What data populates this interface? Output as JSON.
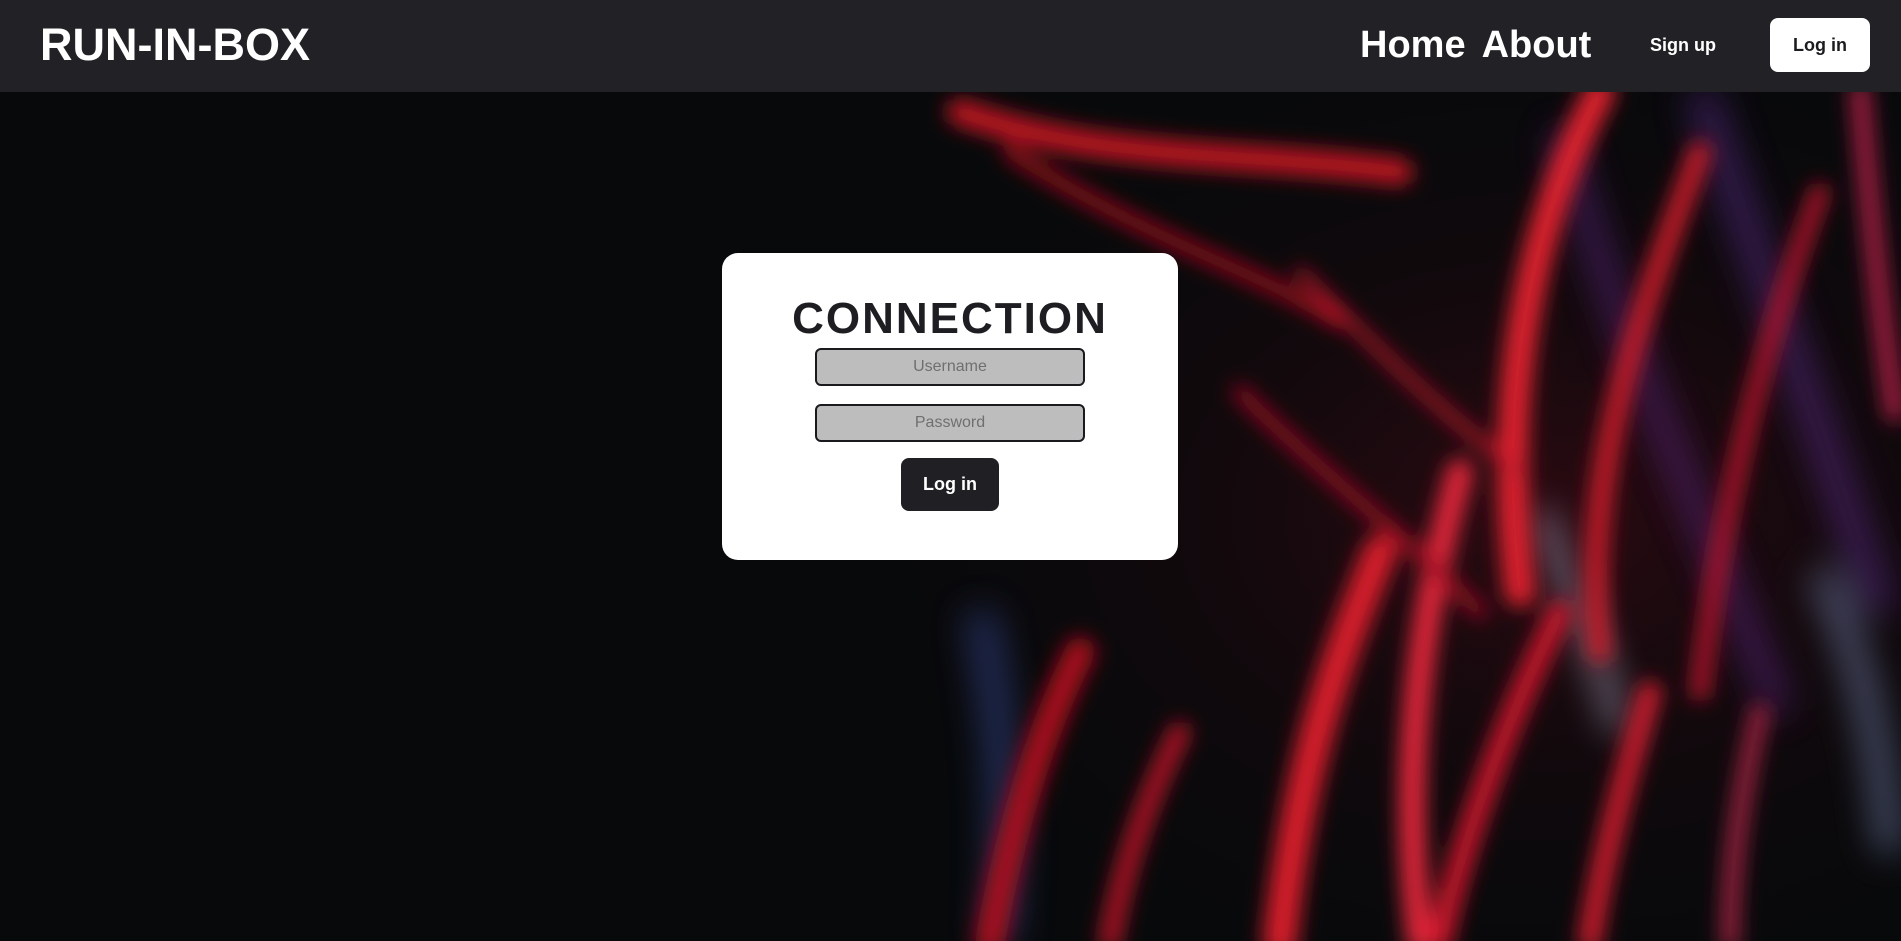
{
  "navbar": {
    "brand": "RUN-IN-BOX",
    "links": [
      {
        "label": "Home"
      },
      {
        "label": "About"
      }
    ],
    "signup_label": "Sign up",
    "login_label": "Log in"
  },
  "login_card": {
    "title": "CONNECTION",
    "username_placeholder": "Username",
    "password_placeholder": "Password",
    "submit_label": "Log in"
  },
  "colors": {
    "navbar_bg": "#212126",
    "accent_red": "#d81a2a",
    "card_bg": "#ffffff",
    "button_dark": "#1f1f24",
    "input_bg": "#bdbdbd"
  },
  "icons": []
}
